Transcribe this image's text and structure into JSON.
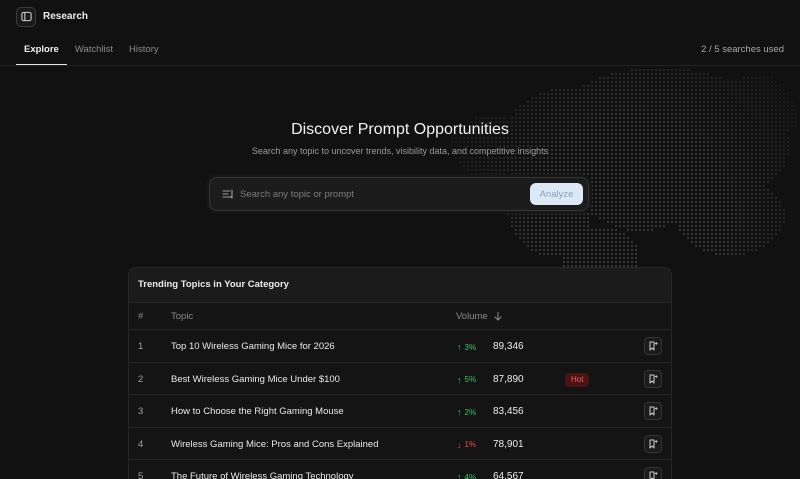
{
  "app": {
    "title": "Research"
  },
  "tabs": [
    {
      "label": "Explore",
      "active": true
    },
    {
      "label": "Watchlist",
      "active": false
    },
    {
      "label": "History",
      "active": false
    }
  ],
  "usage": {
    "text": "2 / 5 searches used"
  },
  "hero": {
    "title": "Discover Prompt Opportunities",
    "subtitle": "Search any topic to uncover trends, visibility data, and competitive insights"
  },
  "search": {
    "placeholder": "Search any topic or prompt",
    "value": "",
    "button_label": "Analyze"
  },
  "trending": {
    "title": "Trending Topics in Your Category",
    "columns": {
      "num": "#",
      "topic": "Topic",
      "volume": "Volume"
    },
    "rows": [
      {
        "num": "1",
        "topic": "Top 10 Wireless Gaming Mice for 2026",
        "change": "3%",
        "direction": "up",
        "volume": "89,346",
        "badge": ""
      },
      {
        "num": "2",
        "topic": "Best Wireless Gaming Mice Under $100",
        "change": "5%",
        "direction": "up",
        "volume": "87,890",
        "badge": "Hot"
      },
      {
        "num": "3",
        "topic": "How to Choose the Right Gaming Mouse",
        "change": "2%",
        "direction": "up",
        "volume": "83,456",
        "badge": ""
      },
      {
        "num": "4",
        "topic": "Wireless Gaming Mice: Pros and Cons Explained",
        "change": "1%",
        "direction": "down",
        "volume": "78,901",
        "badge": ""
      },
      {
        "num": "5",
        "topic": "The Future of Wireless Gaming Technology",
        "change": "4%",
        "direction": "up",
        "volume": "64,567",
        "badge": ""
      }
    ]
  },
  "colors": {
    "up": "#37c46f",
    "down": "#ef4a4a",
    "hot_bg": "#4a1414",
    "hot_text": "#f06060"
  }
}
